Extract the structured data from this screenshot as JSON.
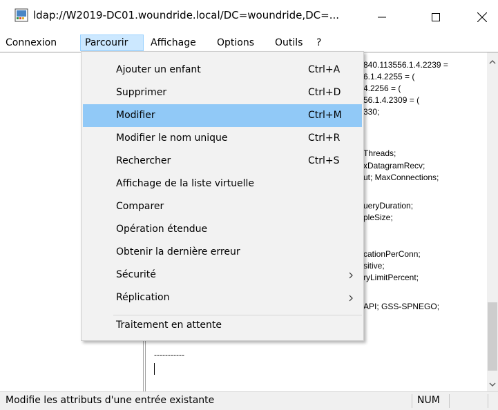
{
  "window": {
    "title": "ldap://W2019-DC01.woundride.local/DC=woundride,DC=...",
    "icons": {
      "app": "ldp-app-icon",
      "minimize": "minimize-icon",
      "maximize": "maximize-icon",
      "close": "close-icon"
    }
  },
  "menubar": {
    "items": [
      {
        "label": "Connexion"
      },
      {
        "label": "Parcourir",
        "active": true
      },
      {
        "label": "Affichage"
      },
      {
        "label": "Options"
      },
      {
        "label": "Outils"
      },
      {
        "label": "?"
      }
    ]
  },
  "dropdown": {
    "items": [
      {
        "label": "Ajouter un enfant",
        "shortcut": "Ctrl+A"
      },
      {
        "label": "Supprimer",
        "shortcut": "Ctrl+D"
      },
      {
        "label": "Modifier",
        "shortcut": "Ctrl+M",
        "highlighted": true
      },
      {
        "label": "Modifier le nom unique",
        "shortcut": "Ctrl+R"
      },
      {
        "label": "Rechercher",
        "shortcut": "Ctrl+S"
      },
      {
        "label": "Affichage de la liste virtuelle",
        "shortcut": ""
      },
      {
        "label": "Comparer",
        "shortcut": ""
      },
      {
        "label": "Opération étendue",
        "shortcut": ""
      },
      {
        "label": "Obtenir la dernière erreur",
        "shortcut": ""
      },
      {
        "label": "Sécurité",
        "shortcut": "",
        "submenu": true
      },
      {
        "label": "Réplication",
        "shortcut": "",
        "submenu": true
      },
      {
        "label": "Traitement en attente",
        "shortcut": ""
      }
    ]
  },
  "output": {
    "lines": [
      "840.113556.1.4.2239 =",
      "6.1.4.2255 = (",
      "4.2256 = (",
      "56.1.4.2309 = (",
      "330;",
      "Threads;",
      "xDatagramRecv;",
      "ut; MaxConnections;",
      "ueryDuration;",
      "pleSize;",
      "cationPerConn;",
      "sitive;",
      "ryLimitPercent;",
      "API; GSS-SPNEGO;"
    ],
    "separator": "-----------"
  },
  "statusbar": {
    "text": "Modifie les attributs d'une entrée existante",
    "num": "NUM"
  },
  "colors": {
    "menu_highlight": "#91c9f7",
    "menubar_active": "#cce8ff",
    "menu_bg": "#f2f2f2"
  }
}
